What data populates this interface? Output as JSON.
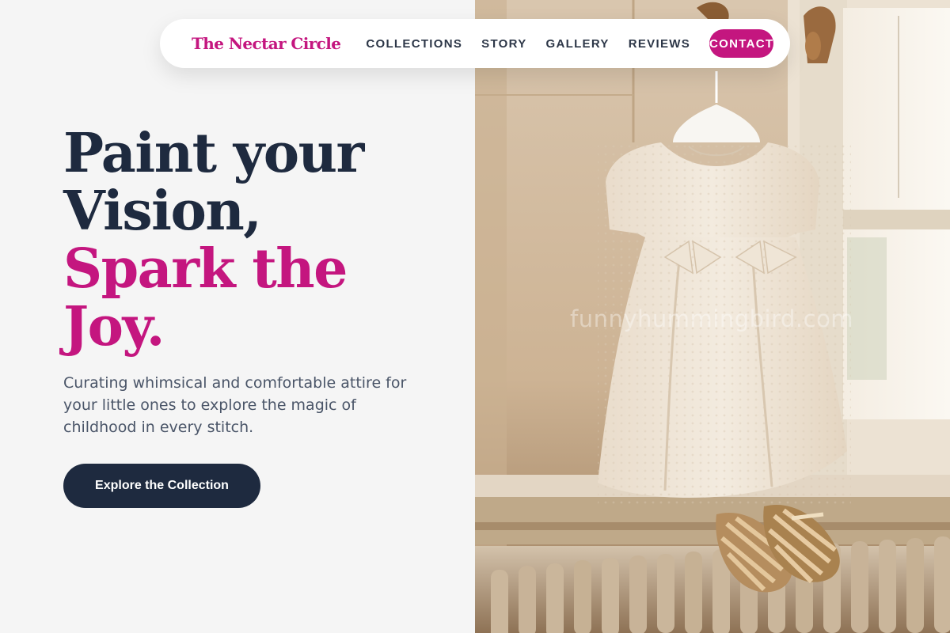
{
  "brand": {
    "name": "The Nectar Circle"
  },
  "nav": {
    "links": [
      "COLLECTIONS",
      "STORY",
      "GALLERY",
      "REVIEWS"
    ],
    "contact_label": "CONTACT"
  },
  "hero": {
    "headline_line1": "Paint your",
    "headline_line2": "Vision,",
    "headline_line3": "Spark the",
    "headline_line4": "Joy.",
    "subtitle": "Curating whimsical and comfortable attire for your little ones to explore the magic of childhood in every stitch.",
    "cta_label": "Explore the Collection"
  },
  "photo": {
    "watermark": "funnyhummingbird.com",
    "subject_icons": [
      "dress-image",
      "sandals-image",
      "radiator-image",
      "window-image"
    ]
  },
  "colors": {
    "accent": "#c4167f",
    "navy": "#1e2a3f",
    "background": "#f5f5f5",
    "body_text": "#4a5568"
  }
}
